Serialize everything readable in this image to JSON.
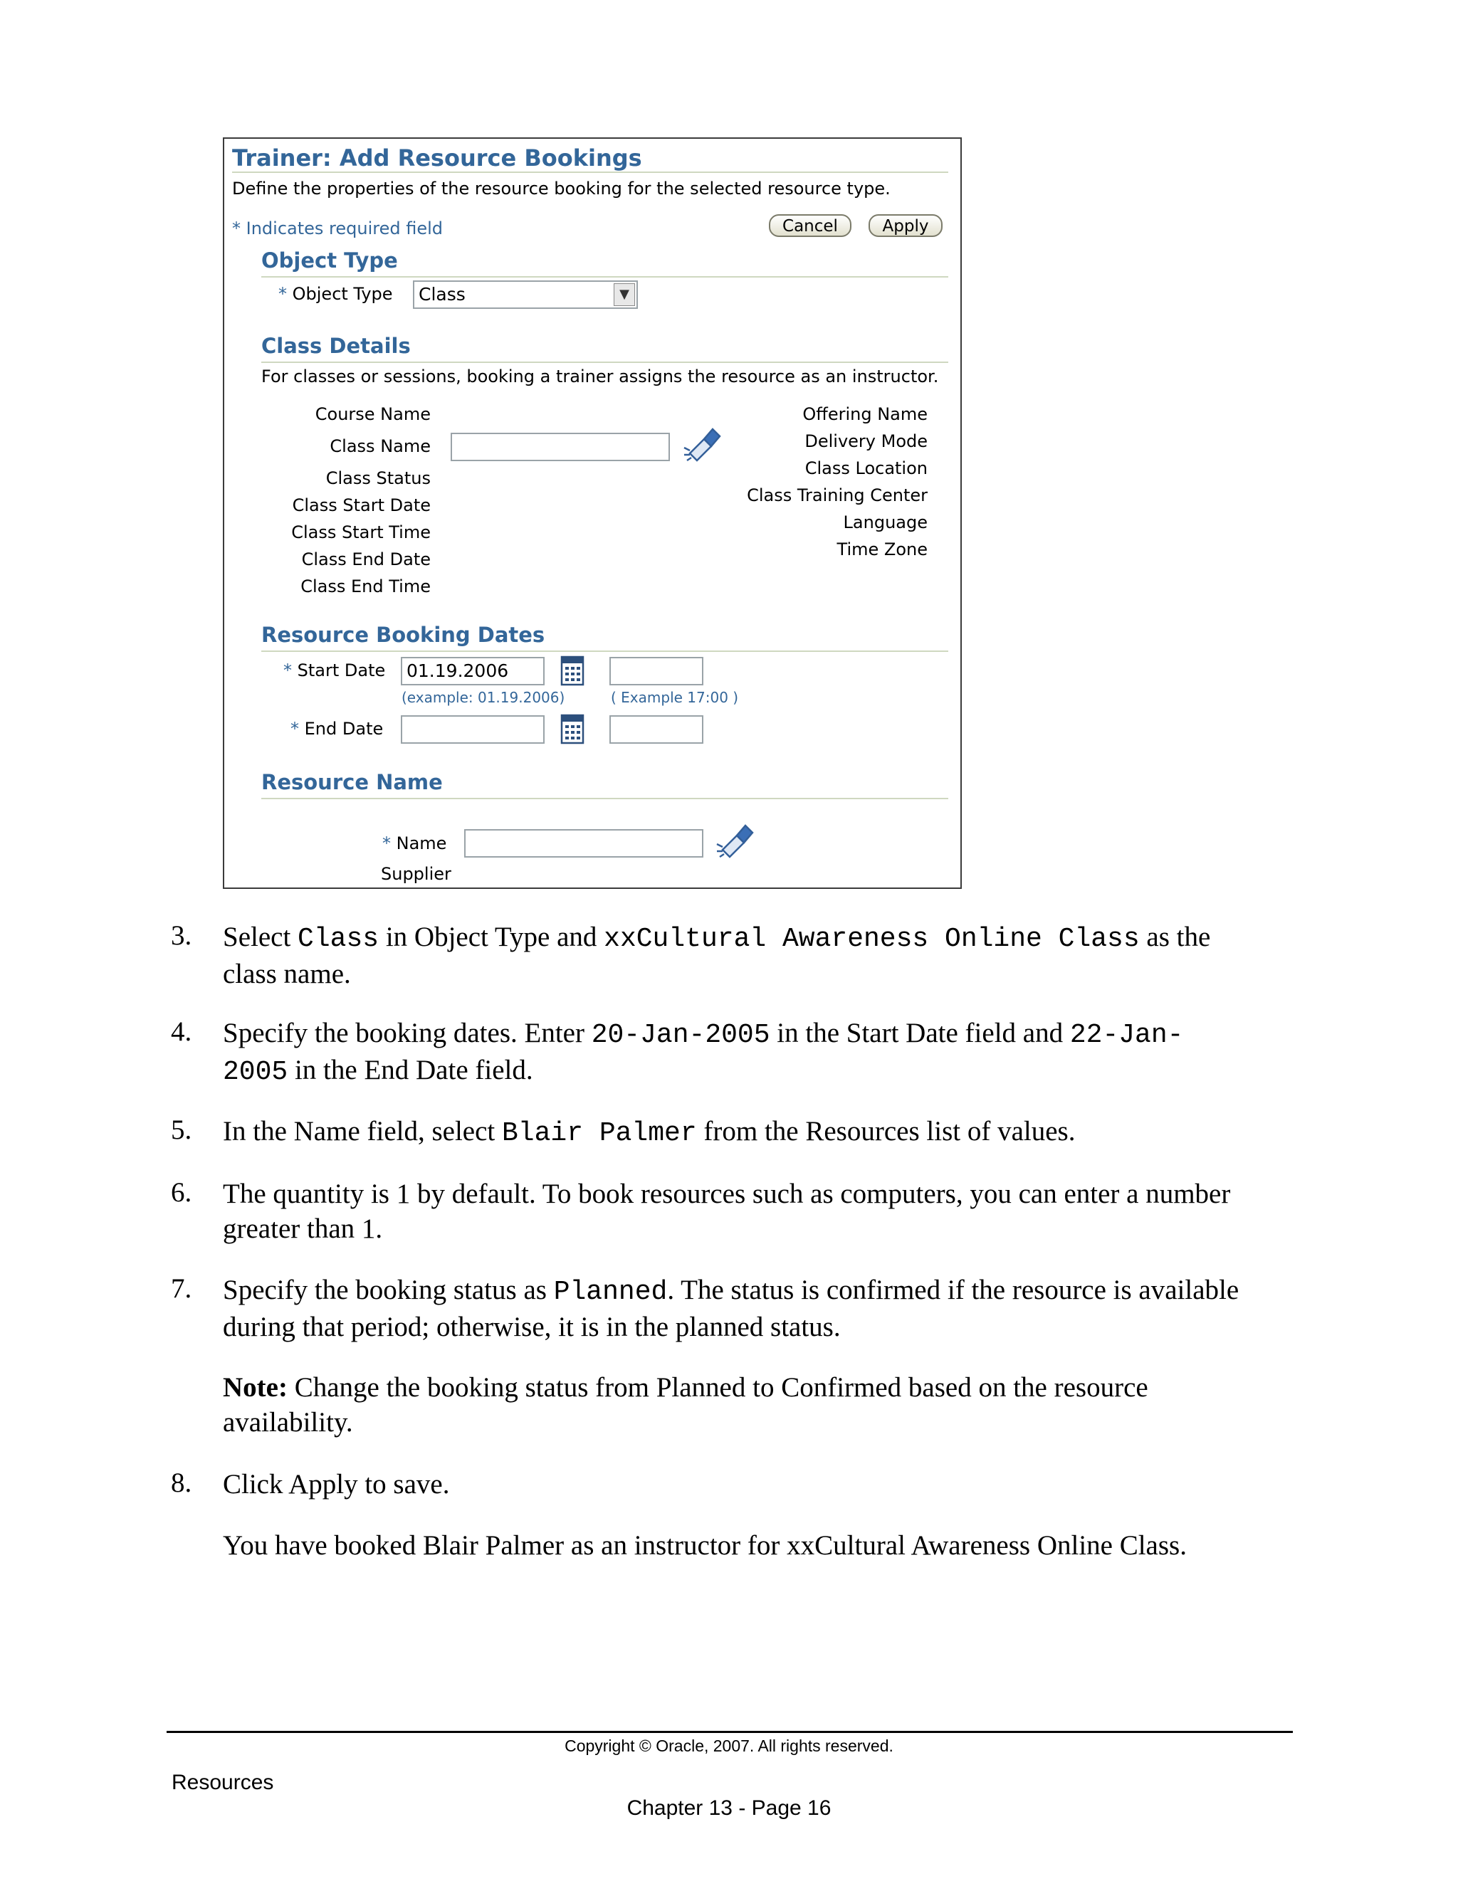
{
  "panel": {
    "title": "Trainer: Add Resource Bookings",
    "description": "Define the properties of the resource booking for the selected resource type.",
    "required_note": "Indicates required field",
    "required_marker": "*",
    "cancel_label": "Cancel",
    "apply_label": "Apply",
    "object_type_section": "Object Type",
    "object_type_label": "Object Type",
    "object_type_value": "Class",
    "class_details_section": "Class Details",
    "class_details_desc": "For classes or sessions, booking a trainer assigns the resource as an instructor.",
    "left_labels": {
      "course_name": "Course Name",
      "class_name": "Class Name",
      "class_status": "Class Status",
      "class_start_date": "Class Start Date",
      "class_start_time": "Class Start Time",
      "class_end_date": "Class End Date",
      "class_end_time": "Class End Time"
    },
    "class_name_value": "",
    "right_labels": {
      "offering_name": "Offering Name",
      "delivery_mode": "Delivery Mode",
      "class_location": "Class Location",
      "class_training_center": "Class Training Center",
      "language": "Language",
      "time_zone": "Time Zone"
    },
    "booking_dates_section": "Resource Booking Dates",
    "start_date_label": "Start Date",
    "start_date_value": "01.19.2006",
    "start_time_value": "",
    "date_hint": "(example: 01.19.2006)",
    "time_hint": "( Example 17:00 )",
    "end_date_label": "End Date",
    "end_date_value": "",
    "end_time_value": "",
    "resource_name_section": "Resource Name",
    "name_label": "Name",
    "name_value": "",
    "supplier_label": "Supplier"
  },
  "steps": [
    {
      "num": "3.",
      "parts": [
        "Select ",
        "Class",
        " in Object Type and ",
        "xxCultural Awareness Online Class",
        " as the"
      ],
      "line2": "class name."
    },
    {
      "num": "4.",
      "parts": [
        "Specify the booking dates. Enter ",
        "20-Jan-2005",
        " in the Start Date field and ",
        "22-Jan-"
      ],
      "line2_parts": [
        "2005",
        " in the End Date field."
      ]
    },
    {
      "num": "5.",
      "parts": [
        "In the Name field, select ",
        "Blair Palmer",
        " from the Resources list of values."
      ]
    },
    {
      "num": "6.",
      "line1": "The quantity is 1 by default. To book resources such as computers, you can enter a number",
      "line2": "greater than 1."
    },
    {
      "num": "7.",
      "parts": [
        "Specify the booking status as ",
        "Planned",
        ". The status is confirmed if the resource is available"
      ],
      "line2": "during that period; otherwise, it is in the planned status."
    },
    {
      "num": "8.",
      "line1": "Click Apply to save."
    }
  ],
  "note": {
    "label": "Note:",
    "line1": " Change the booking status from Planned to Confirmed based on the resource",
    "line2": "availability."
  },
  "conclusion": "You have booked Blair Palmer as an instructor for xxCultural Awareness Online Class.",
  "footer": {
    "copyright": "Copyright © Oracle, 2007. All rights reserved.",
    "left": "Resources",
    "page": "Chapter 13 - Page 16"
  }
}
